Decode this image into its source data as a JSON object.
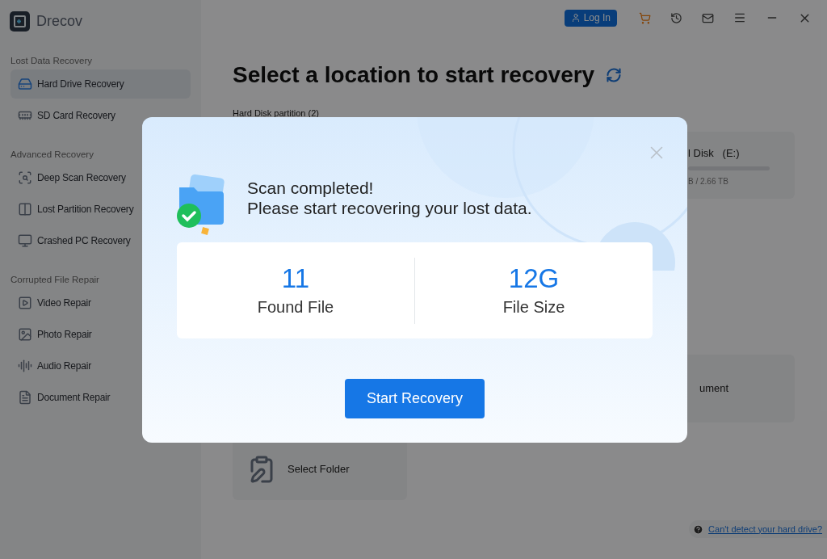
{
  "app": {
    "name": "Drecov"
  },
  "top_bar": {
    "login_label": "Log In"
  },
  "sidebar": {
    "sections": [
      {
        "title": "Lost Data Recovery",
        "items": [
          {
            "label": "Hard Drive Recovery",
            "selected": true
          },
          {
            "label": "SD Card Recovery",
            "selected": false
          }
        ]
      },
      {
        "title": "Advanced Recovery",
        "items": [
          {
            "label": "Deep Scan Recovery",
            "selected": false
          },
          {
            "label": "Lost Partition Recovery",
            "selected": false
          },
          {
            "label": "Crashed PC Recovery",
            "selected": false
          }
        ]
      },
      {
        "title": "Corrupted File Repair",
        "items": [
          {
            "label": "Video Repair",
            "selected": false
          },
          {
            "label": "Photo Repair",
            "selected": false
          },
          {
            "label": "Audio Repair",
            "selected": false
          },
          {
            "label": "Document Repair",
            "selected": false
          }
        ]
      }
    ]
  },
  "main": {
    "title": "Select a location to start recovery",
    "partition_heading": "Hard Disk partition (2)",
    "disk_card": {
      "name": "l Disk   (E:)",
      "usage": "B / 2.66 TB"
    },
    "document_card": {
      "label": "ument"
    },
    "folder_card": {
      "label": "Select Folder"
    },
    "help_link": "Can't detect your hard drive?"
  },
  "dialog": {
    "message_lines": [
      "Scan completed!",
      "Please start recovering your lost data."
    ],
    "stats": [
      {
        "value": "11",
        "label": "Found File"
      },
      {
        "value": "12G",
        "label": "File Size"
      }
    ],
    "button": "Start Recovery"
  }
}
